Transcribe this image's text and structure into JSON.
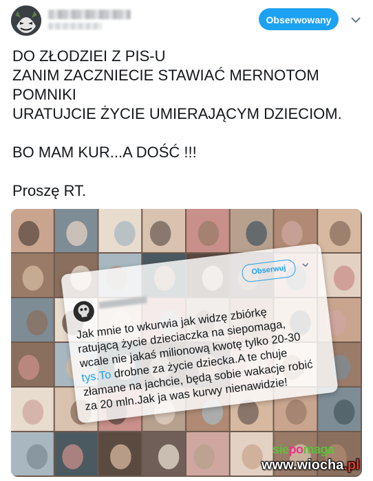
{
  "header": {
    "follow_label": "Obserwowany"
  },
  "tweet": {
    "lines": [
      "DO ZŁODZIEI Z PIS-U",
      "ZANIM ZACZNIECIE STAWIAĆ MERNOTOM",
      "POMNIKI",
      "URATUJCIE ŻYCIE UMIERAJĄCYM DZIECIOM.",
      "",
      "BO MAM KUR...A DOŚĆ !!!",
      "",
      "Proszę RT."
    ]
  },
  "embedded_card": {
    "follow_label": "Obserwuj",
    "lines": [
      "Jak mnie to wkurwia jak widzę zbiórkę",
      "ratującą życie dzieciaczka na siepomaga,",
      "wcale nie jakaś milionową kwotę tylko 20-30",
      "tys.To drobne za życie dziecka.A te chuje",
      "złamane na jachcie, będą sobie wakacje robić",
      "za 20 mln.Jak ja was kurwy nienawidzie!"
    ],
    "link_word": "tys.To"
  },
  "watermarks": {
    "siepomaga": {
      "a": "sie",
      "b": "po",
      "c": "maga"
    },
    "site": {
      "main": "www.wiocha",
      "tld": ".pl"
    }
  },
  "colors": {
    "accent": "#1da1f2",
    "text": "#14171a"
  },
  "icons": {
    "menu": "chevron-down-icon",
    "avatar": "avatar-icon"
  }
}
